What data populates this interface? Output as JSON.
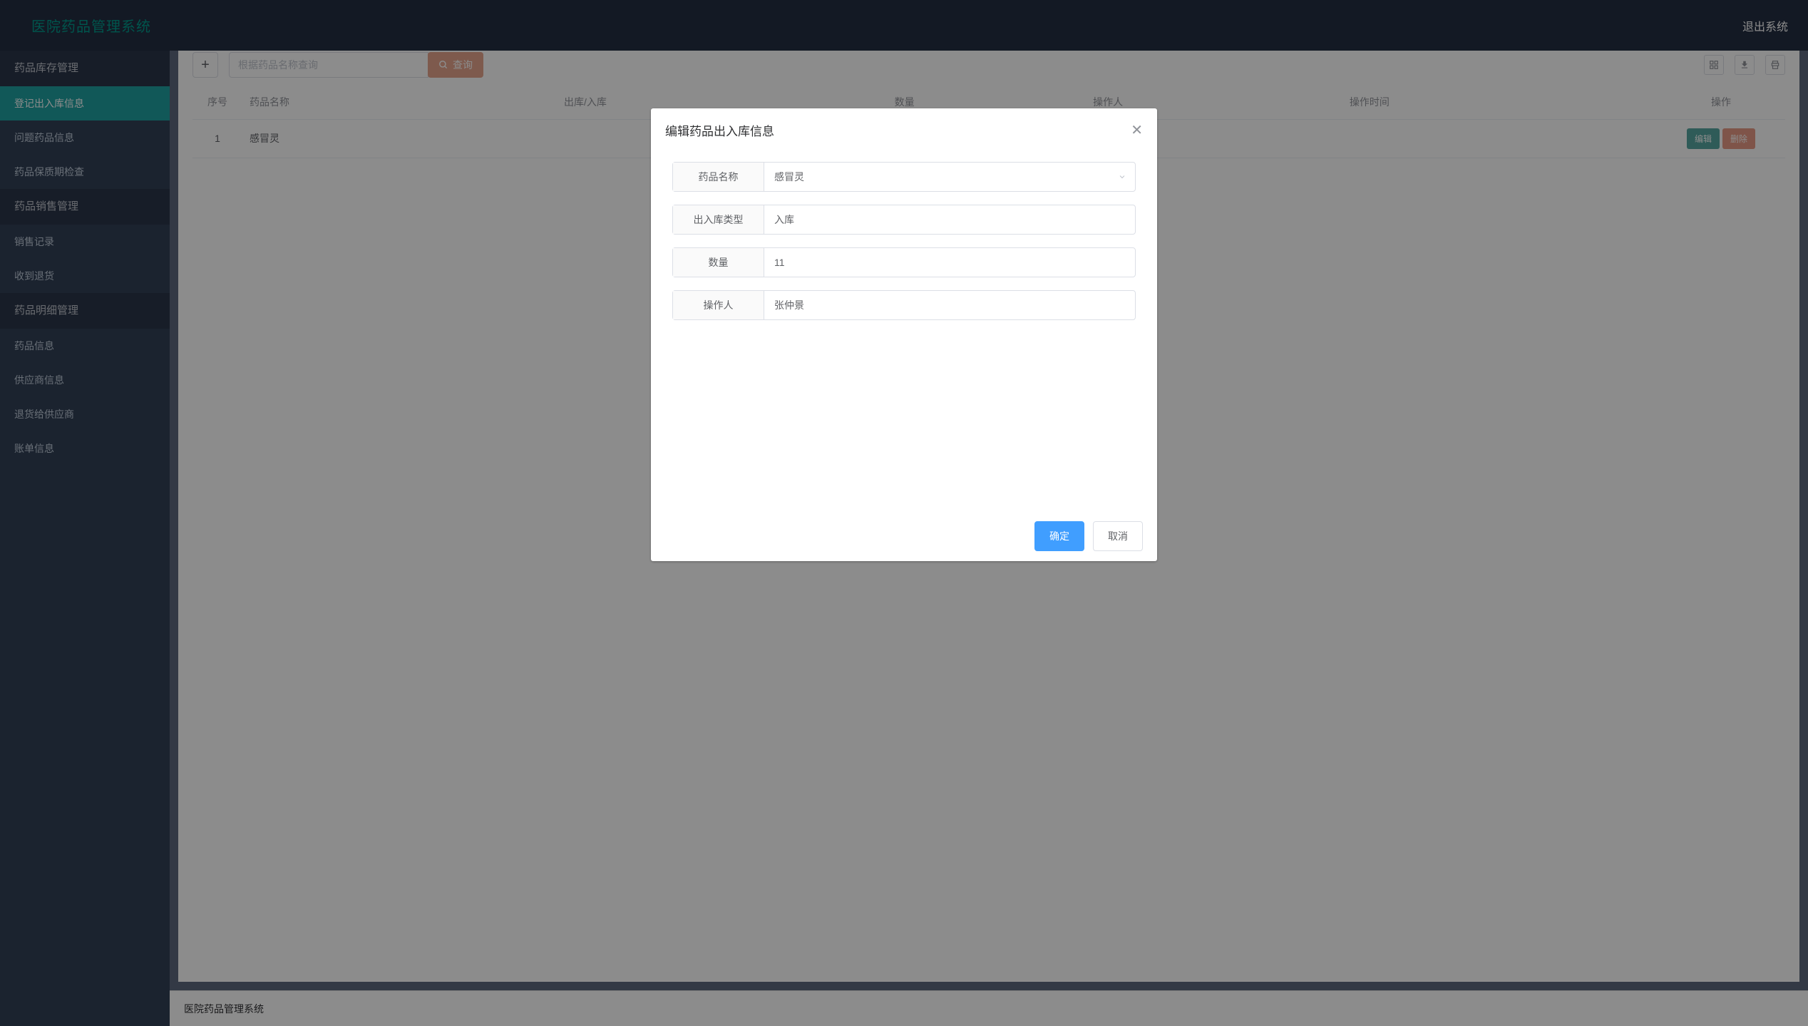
{
  "header": {
    "app_title": "医院药品管理系统",
    "logout_label": "退出系统"
  },
  "sidebar": {
    "groups": [
      {
        "title": "药品库存管理",
        "items": [
          {
            "label": "登记出入库信息",
            "active": true
          },
          {
            "label": "问题药品信息",
            "active": false
          },
          {
            "label": "药品保质期检查",
            "active": false
          }
        ]
      },
      {
        "title": "药品销售管理",
        "items": [
          {
            "label": "销售记录",
            "active": false
          },
          {
            "label": "收到退货",
            "active": false
          }
        ]
      },
      {
        "title": "药品明细管理",
        "items": [
          {
            "label": "药品信息",
            "active": false
          },
          {
            "label": "供应商信息",
            "active": false
          },
          {
            "label": "退货给供应商",
            "active": false
          },
          {
            "label": "账单信息",
            "active": false
          }
        ]
      }
    ]
  },
  "toolbar": {
    "search_placeholder": "根据药品名称查询",
    "search_button": "查询"
  },
  "table": {
    "headers": {
      "index": "序号",
      "name": "药品名称",
      "inout": "出库/入库",
      "qty": "数量",
      "operator": "操作人",
      "time": "操作时间",
      "action": "操作"
    },
    "rows": [
      {
        "index": "1",
        "name": "感冒灵",
        "inout": "",
        "qty": "",
        "operator": "",
        "time": ""
      }
    ],
    "edit_label": "编辑",
    "delete_label": "删除"
  },
  "dialog": {
    "title": "编辑药品出入库信息",
    "fields": {
      "name_label": "药品名称",
      "name_value": "感冒灵",
      "type_label": "出入库类型",
      "type_value": "入库",
      "qty_label": "数量",
      "qty_value": "11",
      "operator_label": "操作人",
      "operator_value": "张仲景"
    },
    "confirm": "确定",
    "cancel": "取消"
  },
  "footer": {
    "text": "医院药品管理系统"
  }
}
